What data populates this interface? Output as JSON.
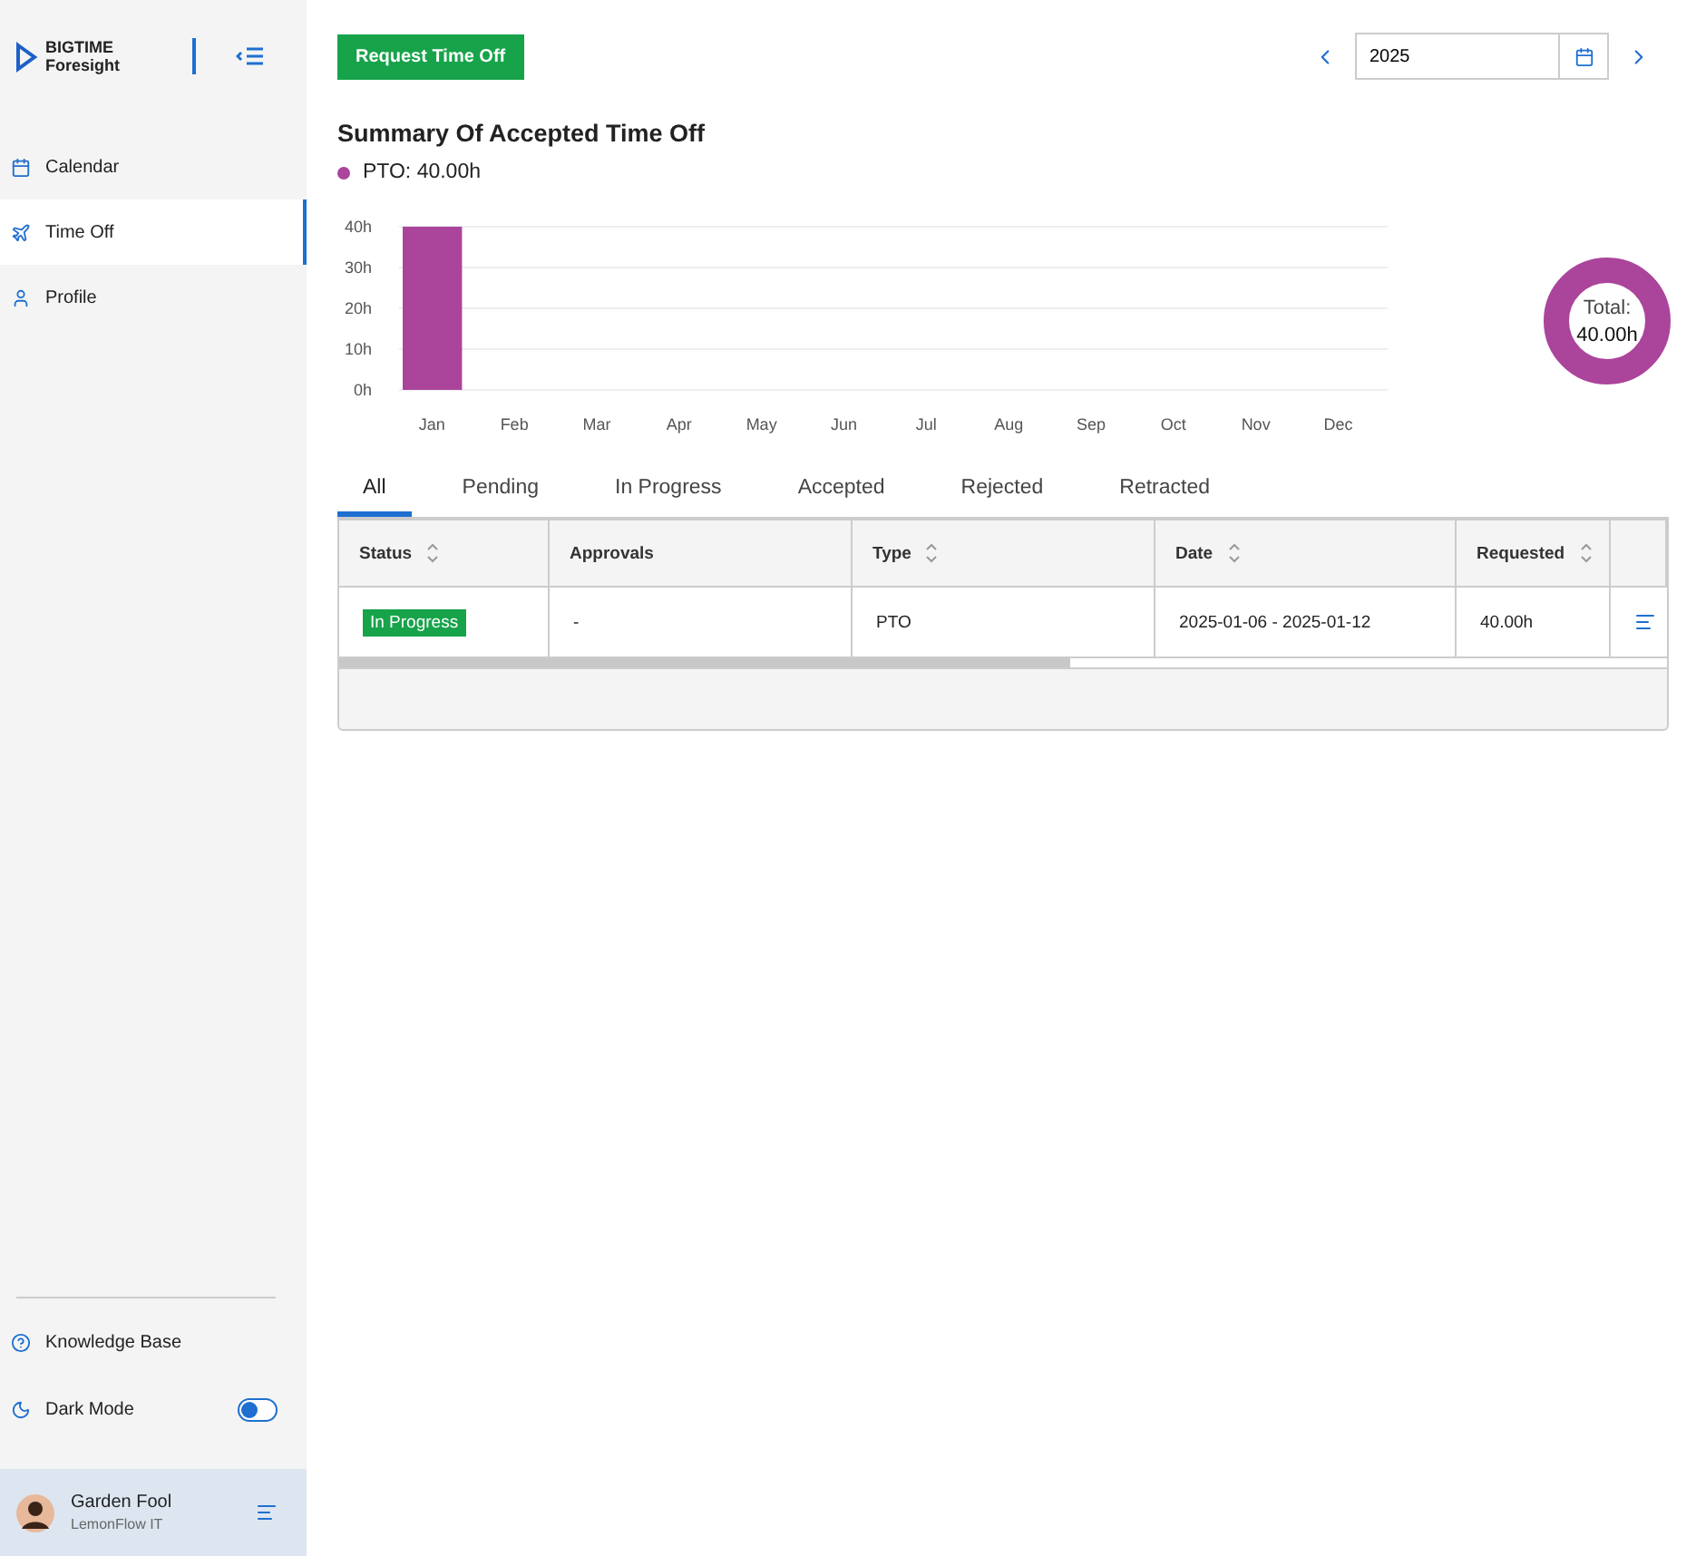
{
  "sidebar": {
    "logo": {
      "line1": "BIGTIME",
      "line2": "Foresight"
    },
    "items": [
      {
        "label": "Calendar",
        "selected": false
      },
      {
        "label": "Time Off",
        "selected": true
      },
      {
        "label": "Profile",
        "selected": false
      }
    ],
    "footer_items": [
      {
        "label": "Knowledge Base",
        "kind": "link"
      },
      {
        "label": "Dark Mode",
        "kind": "toggle",
        "on": false
      }
    ],
    "user": {
      "name": "Garden Fool",
      "company": "LemonFlow IT"
    }
  },
  "toolbar": {
    "request_button": "Request Time Off",
    "year": "2025"
  },
  "summary": {
    "title": "Summary Of Accepted Time Off",
    "legend": [
      {
        "label": "PTO: 40.00h",
        "color": "#ab449b"
      }
    ],
    "chart_data": {
      "type": "bar",
      "categories": [
        "Jan",
        "Feb",
        "Mar",
        "Apr",
        "May",
        "Jun",
        "Jul",
        "Aug",
        "Sep",
        "Oct",
        "Nov",
        "Dec"
      ],
      "series": [
        {
          "color": "#ab449b",
          "values": [
            40,
            0,
            0,
            0,
            0,
            0,
            0,
            0,
            0,
            0,
            0,
            0
          ]
        }
      ],
      "ylim": [
        0,
        40
      ],
      "grid": true,
      "yticks": [
        {
          "value": 0,
          "label": "0h"
        },
        {
          "value": 10,
          "label": "10h"
        },
        {
          "value": 20,
          "label": "20h"
        },
        {
          "value": 30,
          "label": "30h"
        },
        {
          "value": 40,
          "label": "40h"
        }
      ]
    },
    "donut": {
      "label": "Total:",
      "value": "40.00h"
    }
  },
  "tabs": [
    {
      "label": "All",
      "selected": true
    },
    {
      "label": "Pending",
      "selected": false
    },
    {
      "label": "In Progress",
      "selected": false
    },
    {
      "label": "Accepted",
      "selected": false
    },
    {
      "label": "Rejected",
      "selected": false
    },
    {
      "label": "Retracted",
      "selected": false
    }
  ],
  "table": {
    "columns": [
      {
        "label": "Status",
        "sortable": true
      },
      {
        "label": "Approvals",
        "sortable": false
      },
      {
        "label": "Type",
        "sortable": true
      },
      {
        "label": "Date",
        "sortable": true
      },
      {
        "label": "Requested",
        "sortable": true
      }
    ],
    "rows": [
      {
        "status": "In Progress",
        "approvals": "-",
        "type": "PTO",
        "date": "2025-01-06 - 2025-01-12",
        "requested": "40.00h"
      }
    ]
  }
}
